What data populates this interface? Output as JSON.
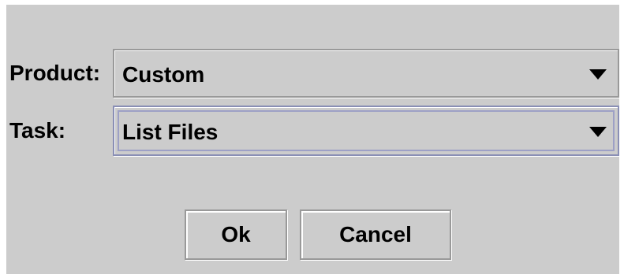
{
  "form": {
    "product_label": "Product:",
    "product_value": "Custom",
    "task_label": "Task:",
    "task_value": "List Files"
  },
  "buttons": {
    "ok_label": "Ok",
    "cancel_label": "Cancel"
  },
  "icons": {
    "dropdown": "chevron-down-icon"
  }
}
